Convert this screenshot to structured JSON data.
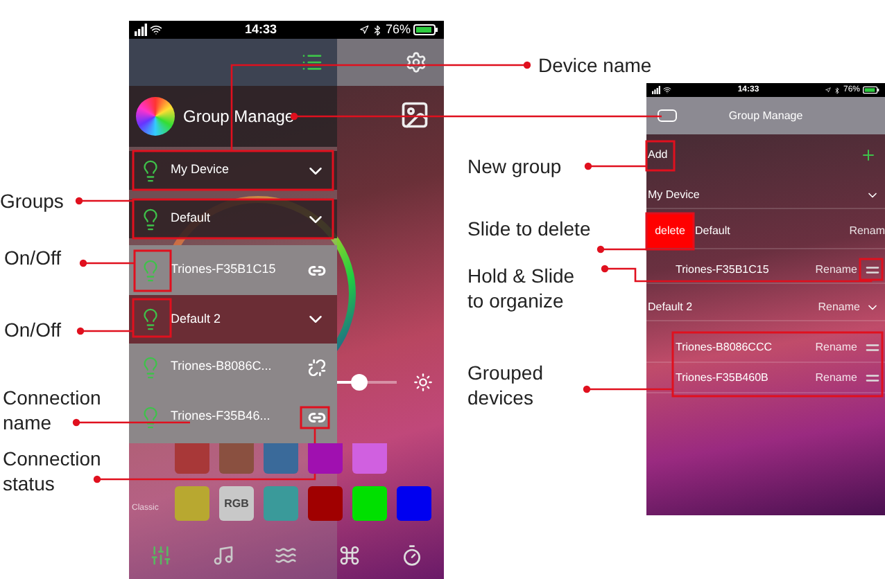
{
  "left_phone": {
    "status_bar": {
      "time": "14:33",
      "battery": "76%"
    },
    "menu": {
      "title": "Group Manage",
      "rows": [
        {
          "kind": "group",
          "name": "My Device",
          "on": true,
          "selected": false
        },
        {
          "kind": "group",
          "name": "Default",
          "on": true,
          "selected": false
        },
        {
          "kind": "device",
          "name": "Triones-F35B1C15",
          "on": true,
          "connected": true,
          "selected": false
        },
        {
          "kind": "group",
          "name": "Default 2",
          "on": true,
          "selected": true
        },
        {
          "kind": "device",
          "name": "Triones-B8086C...",
          "on": true,
          "connected": false,
          "selected": false
        },
        {
          "kind": "device",
          "name": "Triones-F35B46...",
          "on": true,
          "connected": true,
          "selected": false
        }
      ]
    },
    "brightness": {
      "level": 0.85
    },
    "swatch_rows": [
      {
        "swatches": [
          {
            "color": "#a83838"
          },
          {
            "color": "#8a5040"
          },
          {
            "color": "#3a6a9a"
          },
          {
            "color": "#a010b0"
          },
          {
            "color": "#d060e0"
          }
        ]
      },
      {
        "label": "Classic",
        "swatches": [
          {
            "color": "#b8a830"
          },
          {
            "color": "#c8c8c8",
            "text": "RGB"
          },
          {
            "color": "#3a9a9a"
          },
          {
            "color": "#a00000"
          },
          {
            "color": "#00e000"
          },
          {
            "color": "#0000f0"
          }
        ]
      }
    ],
    "tab_bar": [
      {
        "selected": true
      },
      {
        "selected": false
      },
      {
        "selected": false
      },
      {
        "selected": false
      },
      {
        "selected": false
      }
    ]
  },
  "right_phone": {
    "status_bar": {
      "time": "14:33",
      "battery": "76%"
    },
    "title": "Group Manage",
    "add_label": "Add",
    "rows": [
      {
        "kind": "group",
        "name": "My Device"
      },
      {
        "kind": "group",
        "name": "Default",
        "delete_label": "delete",
        "action": "Renam"
      },
      {
        "kind": "device",
        "name": "Triones-F35B1C15",
        "action": "Rename"
      },
      {
        "kind": "group",
        "name": "Default 2",
        "action": "Rename"
      },
      {
        "kind": "device",
        "name": "Triones-B8086CCC",
        "action": "Rename"
      },
      {
        "kind": "device",
        "name": "Triones-F35B460B",
        "action": "Rename"
      }
    ]
  },
  "annotations": [
    {
      "text": "Device name"
    },
    {
      "text": "Groups"
    },
    {
      "text": "On/Off"
    },
    {
      "text": "On/Off"
    },
    {
      "text": "Connection name"
    },
    {
      "text": "Connection status"
    },
    {
      "text": "New group"
    },
    {
      "text": "Slide to delete"
    },
    {
      "text": "Hold & Slide to organize"
    },
    {
      "text": "Grouped devices"
    }
  ]
}
